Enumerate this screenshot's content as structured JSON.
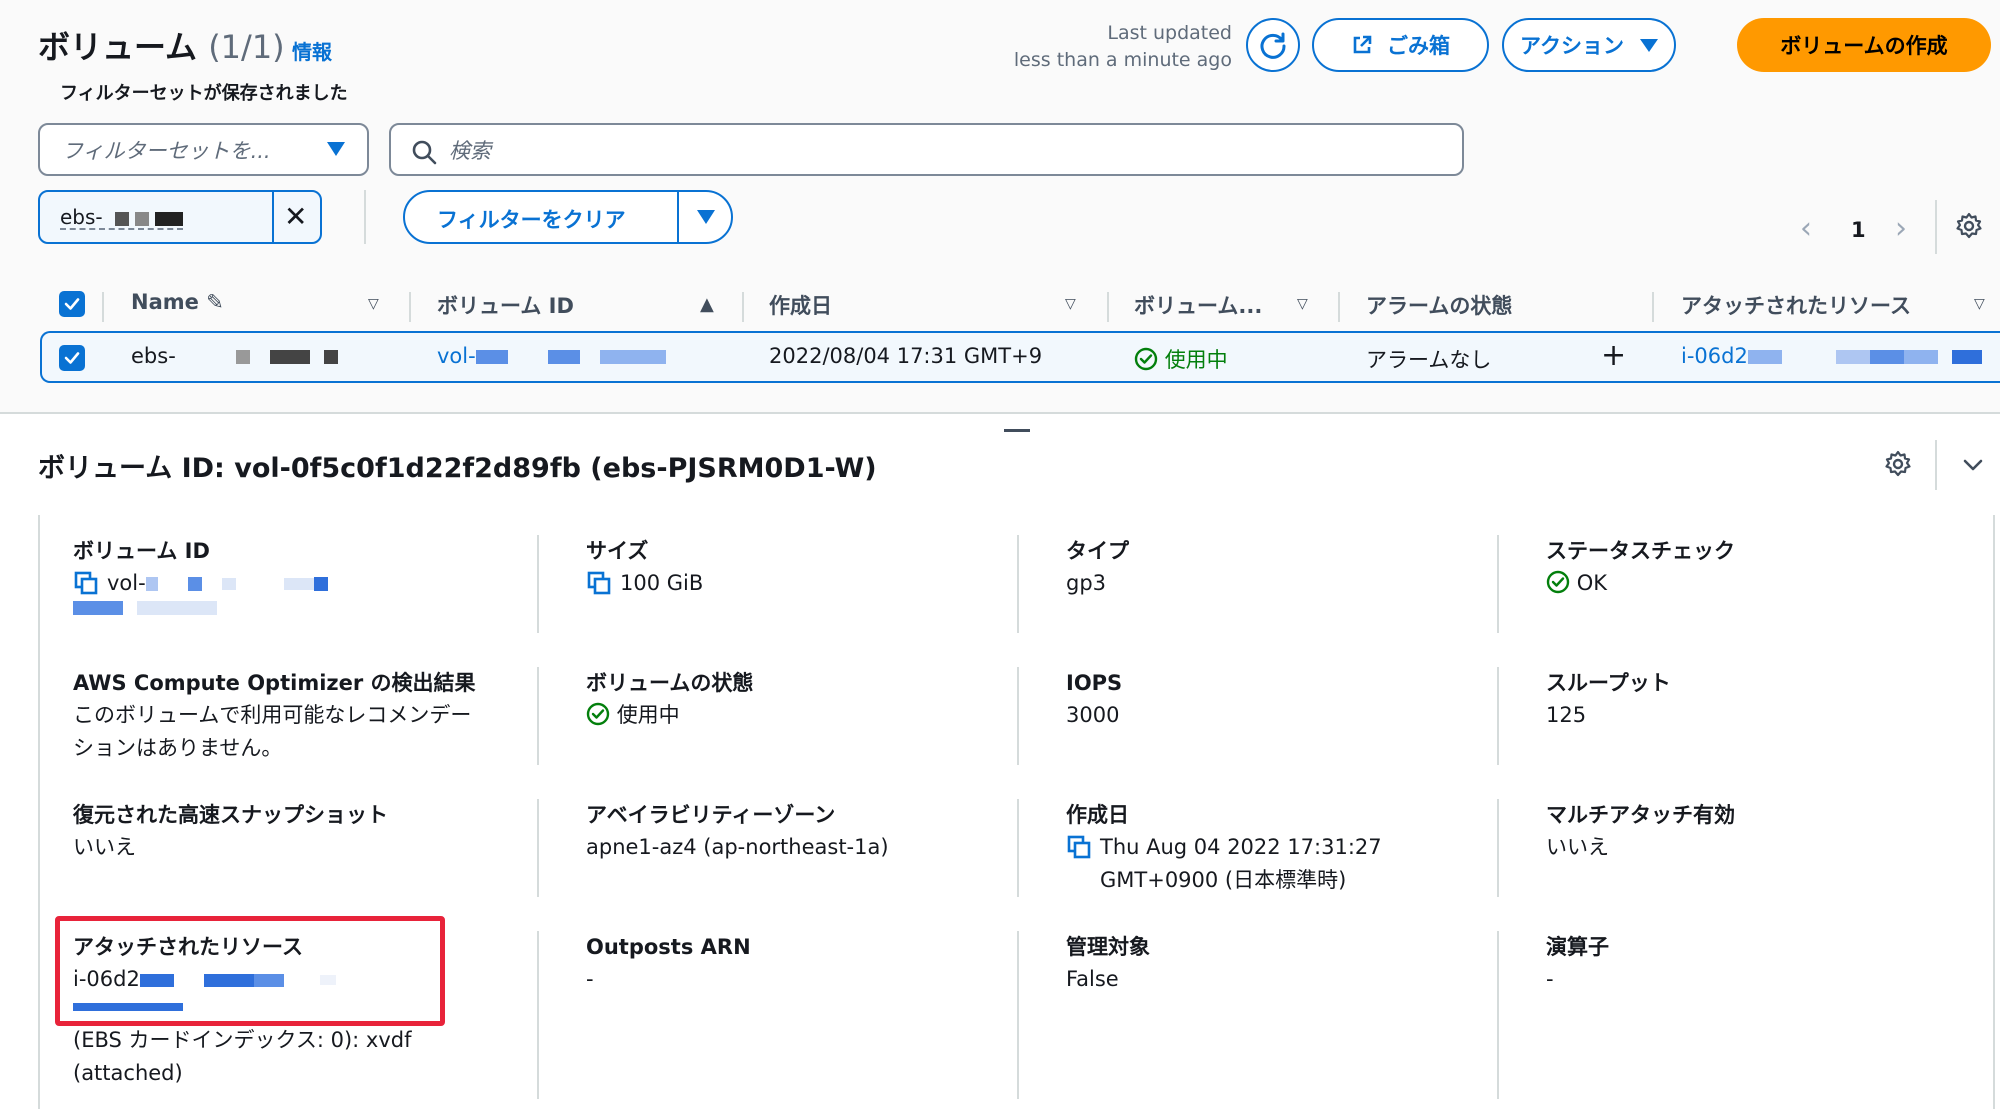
{
  "header": {
    "title": "ボリューム",
    "count": "(1/1)",
    "info_link": "情報",
    "last_updated_label": "Last updated",
    "last_updated_value": "less than a minute ago",
    "trash_label": "ごみ箱",
    "actions_label": "アクション",
    "create_label": "ボリュームの作成"
  },
  "filters": {
    "filterset_label": "フィルターセットが保存されました",
    "filterset_placeholder": "フィルターセットを...",
    "search_placeholder": "検索",
    "token_label": "ebs-",
    "clear_label": "フィルターをクリア"
  },
  "pagination": {
    "current_page": "1"
  },
  "table": {
    "headers": [
      "Name",
      "ボリューム ID",
      "作成日",
      "ボリューム...",
      "アラームの状態",
      "アタッチされたリソース"
    ],
    "row": {
      "name": "ebs-",
      "volume_id": "vol-",
      "created": "2022/08/04 17:31 GMT+9",
      "state": "使用中",
      "alarm": "アラームなし",
      "attached": "i-06d2"
    }
  },
  "details": {
    "title": "ボリューム ID: vol-0f5c0f1d22f2d89fb (ebs-PJSRM0D1-W)",
    "fields": {
      "volume_id": {
        "label": "ボリューム ID",
        "value": "vol-"
      },
      "size": {
        "label": "サイズ",
        "value": "100 GiB"
      },
      "type": {
        "label": "タイプ",
        "value": "gp3"
      },
      "status_check": {
        "label": "ステータスチェック",
        "value": "OK"
      },
      "optimizer": {
        "label": "AWS Compute Optimizer の検出結果",
        "value": "このボリュームで利用可能なレコメンデーションはありません。"
      },
      "volume_state": {
        "label": "ボリュームの状態",
        "value": "使用中"
      },
      "iops": {
        "label": "IOPS",
        "value": "3000"
      },
      "throughput": {
        "label": "スループット",
        "value": "125"
      },
      "fast_snapshot": {
        "label": "復元された高速スナップショット",
        "value": "いいえ"
      },
      "az": {
        "label": "アベイラビリティーゾーン",
        "value": "apne1-az4 (ap-northeast-1a)"
      },
      "created": {
        "label": "作成日",
        "value": "Thu Aug 04 2022 17:31:27 GMT+0900 (日本標準時)"
      },
      "multi_attach": {
        "label": "マルチアタッチ有効",
        "value": "いいえ"
      },
      "attached": {
        "label": "アタッチされたリソース",
        "value": "i-06d2",
        "extra": "(EBS カードインデックス: 0): xvdf (attached)"
      },
      "outposts": {
        "label": "Outposts ARN",
        "value": "-"
      },
      "managed": {
        "label": "管理対象",
        "value": "False"
      },
      "operator": {
        "label": "演算子",
        "value": "-"
      }
    }
  },
  "colors": {
    "accent": "#0972d3",
    "primary_button": "#ff9900",
    "success": "#037f0c",
    "highlight_box": "#e8233a"
  }
}
